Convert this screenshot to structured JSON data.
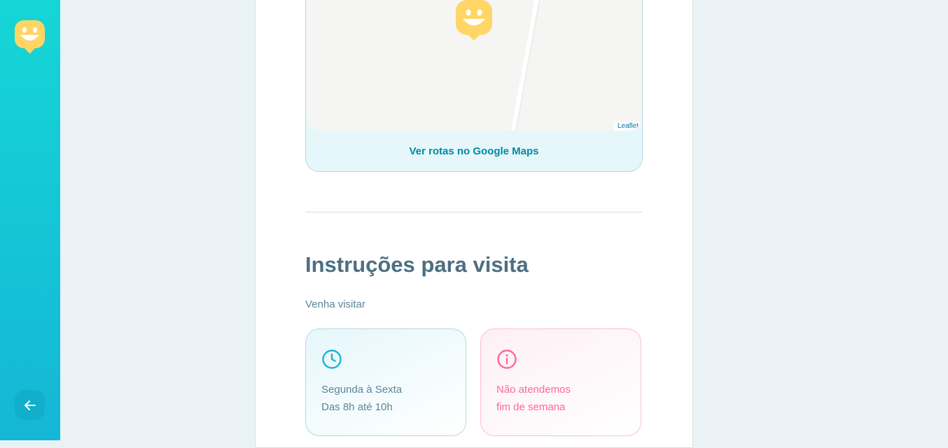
{
  "sidebar": {
    "logo_icon": "smiley-map-marker-icon",
    "back_icon": "arrow-left-icon"
  },
  "map": {
    "attribution": "Leaflet",
    "pin_icon": "smiley-map-marker-icon",
    "directions_link": "Ver rotas no Google Maps"
  },
  "instructions": {
    "title": "Instruções para visita",
    "description": "Venha visitar",
    "hours": {
      "icon": "clock-icon",
      "line1": "Segunda à Sexta",
      "line2": "Das 8h até 10h"
    },
    "weekend": {
      "icon": "info-icon",
      "line1": "Não atendemos",
      "line2": "fim de semana"
    }
  },
  "colors": {
    "sidebar_gradient_start": "#15d6d6",
    "sidebar_gradient_end": "#15b6d6",
    "logo_yellow": "#ffd666",
    "hours_accent": "#15b6d6",
    "weekend_accent": "#ff669d",
    "title": "#4d6f80"
  }
}
